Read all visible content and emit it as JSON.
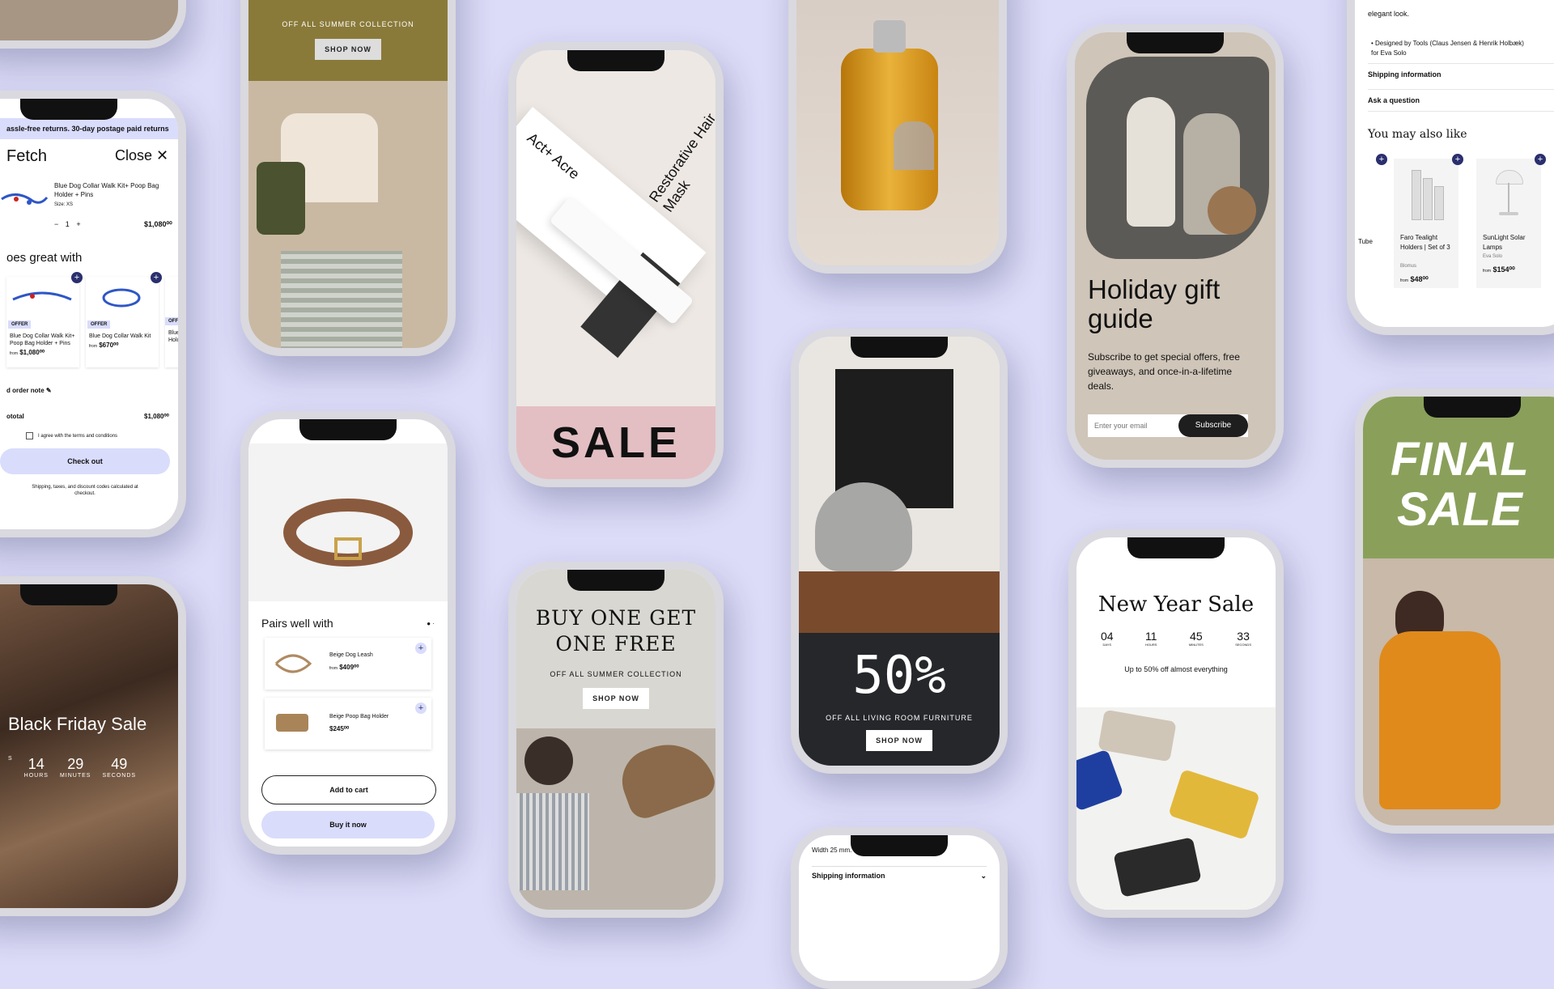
{
  "colors": {
    "background": "#dcdcf8",
    "accent": "#2a2f6e",
    "olive": "#8a7a3a",
    "sale_green": "#8aa05a",
    "buy_lavender": "#d9dcfb"
  },
  "cart": {
    "banner": "assle-free returns. 30-day postage paid returns",
    "title": "Fetch",
    "close_label": "Close",
    "item_title": "Blue Dog Collar Walk Kit+ Poop Bag Holder + Pins",
    "item_size": "Size: XS",
    "qty": "1",
    "item_price": "$1,080⁰⁰",
    "goes_with_title": "oes great with",
    "recs": [
      {
        "badge": "OFFER",
        "name": "Blue Dog Collar Walk Kit+ Poop Bag Holder + Pins",
        "price": "$1,080⁰⁰"
      },
      {
        "badge": "OFFER",
        "name": "Blue Dog Collar Walk Kit",
        "price": "$670⁰⁰"
      },
      {
        "badge": "OFFE",
        "name": "Blue Walk Hold",
        "price": "$"
      }
    ],
    "from_label": "from",
    "order_note": "d order note",
    "subtotal_label": "ototal",
    "subtotal_value": "$1,080⁰⁰",
    "terms": "I agree with the terms and conditions",
    "checkout": "Check out",
    "shipping_note": "Shipping, taxes, and discount codes calculated at checkout."
  },
  "summer_top": {
    "subtitle": "OFF ALL SUMMER COLLECTION",
    "button": "SHOP NOW"
  },
  "actacre": {
    "brand": "Act+ Acre",
    "product": "Restorative Hair Mask",
    "sale": "SALE"
  },
  "oil": {},
  "holiday": {
    "title": "Holiday gift guide",
    "body": "Subscribe to get special offers, free giveaways, and once-in-a-lifetime deals.",
    "email_placeholder": "Enter your email",
    "subscribe": "Subscribe"
  },
  "product_page": {
    "bullet_prev": "elegant look.",
    "bullet": "Designed by Tools (Claus Jensen & Henrik Holbæk) for Eva Solo",
    "shipping": "Shipping information",
    "ask": "Ask a question",
    "also_like": "You may also like",
    "cards": [
      {
        "name": "Tube",
        "brand": "",
        "price": ""
      },
      {
        "name": "Faro Tealight Holders | Set of 3",
        "brand": "Blomus",
        "price": "$48⁰⁰"
      },
      {
        "name": "SunLight Solar Lamps",
        "brand": "Eva Solo",
        "price": "$154⁰⁰"
      }
    ],
    "from_label": "from"
  },
  "collar": {
    "pairs_title": "Pairs well with",
    "items": [
      {
        "name": "Beige Dog Leash",
        "price": "$409⁰⁰",
        "from": "from"
      },
      {
        "name": "Beige Poop Bag Holder",
        "price": "$245⁰⁰",
        "from": ""
      }
    ],
    "add_to_cart": "Add to cart",
    "buy_now": "Buy it now"
  },
  "living": {
    "big": "50%",
    "subtitle": "OFF ALL LIVING ROOM FURNITURE",
    "button": "SHOP NOW"
  },
  "bogo": {
    "title": "BUY ONE GET ONE FREE",
    "subtitle": "OFF ALL SUMMER COLLECTION",
    "button": "SHOP NOW"
  },
  "newyear": {
    "title": "New Year Sale",
    "timer": [
      {
        "v": "04",
        "l": "DAYS"
      },
      {
        "v": "11",
        "l": "HOURS"
      },
      {
        "v": "45",
        "l": "MINUTES"
      },
      {
        "v": "33",
        "l": "SECONDS"
      }
    ],
    "subtitle": "Up to 50% off almost everything"
  },
  "final": {
    "line1": "FINAL",
    "line2": "SALE"
  },
  "blackfriday": {
    "title": "Black Friday Sale",
    "timer": [
      {
        "v": "",
        "l": "S"
      },
      {
        "v": "14",
        "l": "HOURS"
      },
      {
        "v": "29",
        "l": "MINUTES"
      },
      {
        "v": "49",
        "l": "SECONDS"
      }
    ]
  },
  "bottom_center": {
    "width": "Width 25 mm.",
    "shipping": "Shipping information"
  }
}
